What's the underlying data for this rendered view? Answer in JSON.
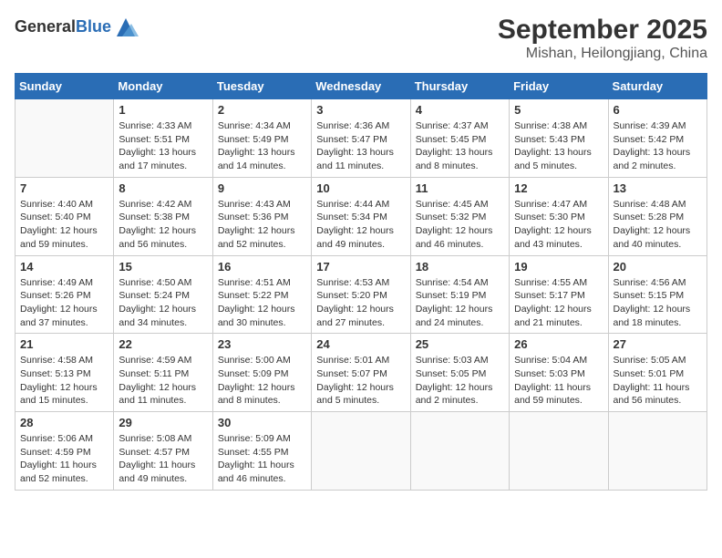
{
  "header": {
    "logo_general": "General",
    "logo_blue": "Blue",
    "month_title": "September 2025",
    "location": "Mishan, Heilongjiang, China"
  },
  "weekdays": [
    "Sunday",
    "Monday",
    "Tuesday",
    "Wednesday",
    "Thursday",
    "Friday",
    "Saturday"
  ],
  "weeks": [
    [
      {
        "day": "",
        "info": ""
      },
      {
        "day": "1",
        "info": "Sunrise: 4:33 AM\nSunset: 5:51 PM\nDaylight: 13 hours\nand 17 minutes."
      },
      {
        "day": "2",
        "info": "Sunrise: 4:34 AM\nSunset: 5:49 PM\nDaylight: 13 hours\nand 14 minutes."
      },
      {
        "day": "3",
        "info": "Sunrise: 4:36 AM\nSunset: 5:47 PM\nDaylight: 13 hours\nand 11 minutes."
      },
      {
        "day": "4",
        "info": "Sunrise: 4:37 AM\nSunset: 5:45 PM\nDaylight: 13 hours\nand 8 minutes."
      },
      {
        "day": "5",
        "info": "Sunrise: 4:38 AM\nSunset: 5:43 PM\nDaylight: 13 hours\nand 5 minutes."
      },
      {
        "day": "6",
        "info": "Sunrise: 4:39 AM\nSunset: 5:42 PM\nDaylight: 13 hours\nand 2 minutes."
      }
    ],
    [
      {
        "day": "7",
        "info": "Sunrise: 4:40 AM\nSunset: 5:40 PM\nDaylight: 12 hours\nand 59 minutes."
      },
      {
        "day": "8",
        "info": "Sunrise: 4:42 AM\nSunset: 5:38 PM\nDaylight: 12 hours\nand 56 minutes."
      },
      {
        "day": "9",
        "info": "Sunrise: 4:43 AM\nSunset: 5:36 PM\nDaylight: 12 hours\nand 52 minutes."
      },
      {
        "day": "10",
        "info": "Sunrise: 4:44 AM\nSunset: 5:34 PM\nDaylight: 12 hours\nand 49 minutes."
      },
      {
        "day": "11",
        "info": "Sunrise: 4:45 AM\nSunset: 5:32 PM\nDaylight: 12 hours\nand 46 minutes."
      },
      {
        "day": "12",
        "info": "Sunrise: 4:47 AM\nSunset: 5:30 PM\nDaylight: 12 hours\nand 43 minutes."
      },
      {
        "day": "13",
        "info": "Sunrise: 4:48 AM\nSunset: 5:28 PM\nDaylight: 12 hours\nand 40 minutes."
      }
    ],
    [
      {
        "day": "14",
        "info": "Sunrise: 4:49 AM\nSunset: 5:26 PM\nDaylight: 12 hours\nand 37 minutes."
      },
      {
        "day": "15",
        "info": "Sunrise: 4:50 AM\nSunset: 5:24 PM\nDaylight: 12 hours\nand 34 minutes."
      },
      {
        "day": "16",
        "info": "Sunrise: 4:51 AM\nSunset: 5:22 PM\nDaylight: 12 hours\nand 30 minutes."
      },
      {
        "day": "17",
        "info": "Sunrise: 4:53 AM\nSunset: 5:20 PM\nDaylight: 12 hours\nand 27 minutes."
      },
      {
        "day": "18",
        "info": "Sunrise: 4:54 AM\nSunset: 5:19 PM\nDaylight: 12 hours\nand 24 minutes."
      },
      {
        "day": "19",
        "info": "Sunrise: 4:55 AM\nSunset: 5:17 PM\nDaylight: 12 hours\nand 21 minutes."
      },
      {
        "day": "20",
        "info": "Sunrise: 4:56 AM\nSunset: 5:15 PM\nDaylight: 12 hours\nand 18 minutes."
      }
    ],
    [
      {
        "day": "21",
        "info": "Sunrise: 4:58 AM\nSunset: 5:13 PM\nDaylight: 12 hours\nand 15 minutes."
      },
      {
        "day": "22",
        "info": "Sunrise: 4:59 AM\nSunset: 5:11 PM\nDaylight: 12 hours\nand 11 minutes."
      },
      {
        "day": "23",
        "info": "Sunrise: 5:00 AM\nSunset: 5:09 PM\nDaylight: 12 hours\nand 8 minutes."
      },
      {
        "day": "24",
        "info": "Sunrise: 5:01 AM\nSunset: 5:07 PM\nDaylight: 12 hours\nand 5 minutes."
      },
      {
        "day": "25",
        "info": "Sunrise: 5:03 AM\nSunset: 5:05 PM\nDaylight: 12 hours\nand 2 minutes."
      },
      {
        "day": "26",
        "info": "Sunrise: 5:04 AM\nSunset: 5:03 PM\nDaylight: 11 hours\nand 59 minutes."
      },
      {
        "day": "27",
        "info": "Sunrise: 5:05 AM\nSunset: 5:01 PM\nDaylight: 11 hours\nand 56 minutes."
      }
    ],
    [
      {
        "day": "28",
        "info": "Sunrise: 5:06 AM\nSunset: 4:59 PM\nDaylight: 11 hours\nand 52 minutes."
      },
      {
        "day": "29",
        "info": "Sunrise: 5:08 AM\nSunset: 4:57 PM\nDaylight: 11 hours\nand 49 minutes."
      },
      {
        "day": "30",
        "info": "Sunrise: 5:09 AM\nSunset: 4:55 PM\nDaylight: 11 hours\nand 46 minutes."
      },
      {
        "day": "",
        "info": ""
      },
      {
        "day": "",
        "info": ""
      },
      {
        "day": "",
        "info": ""
      },
      {
        "day": "",
        "info": ""
      }
    ]
  ]
}
